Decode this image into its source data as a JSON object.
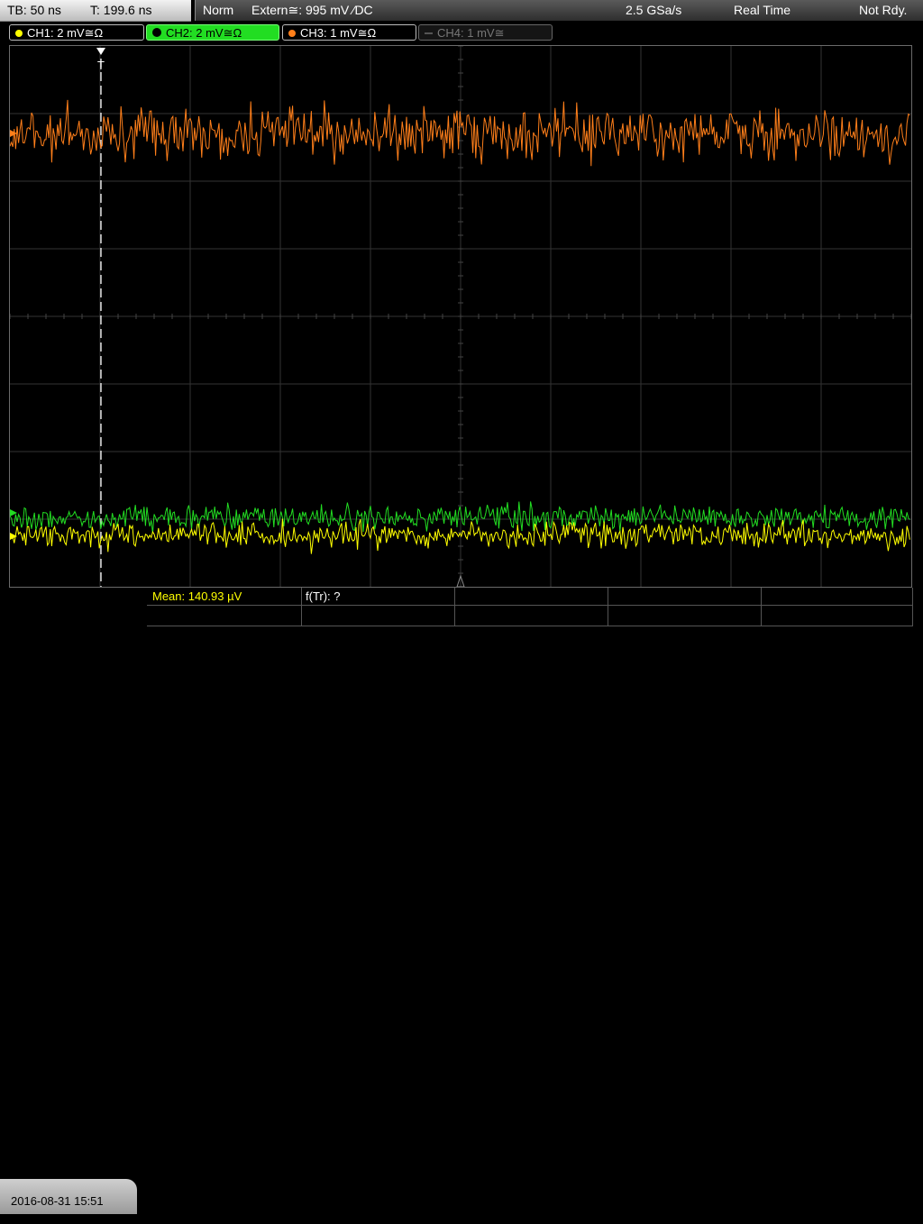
{
  "header": {
    "timebase": "TB: 50 ns",
    "trigger_time": "T: 199.6 ns",
    "mode": "Norm",
    "trigger_source": "Extern≅: 995 mV ⁄DC",
    "sample_rate": "2.5 GSa/s",
    "acq_mode": "Real Time",
    "status": "Not Rdy."
  },
  "channels": [
    {
      "label": "CH1: 2 mV≅Ω",
      "color": "#ffff00",
      "state": "on"
    },
    {
      "label": "CH2: 2 mV≅Ω",
      "color": "#22dd22",
      "state": "selected"
    },
    {
      "label": "CH3: 1 mV≅Ω",
      "color": "#ff7f1a",
      "state": "on"
    },
    {
      "label": "CH4: 1 mV≅",
      "color": "#777777",
      "state": "off"
    }
  ],
  "trigger_marker": "T",
  "measurements": {
    "mean": "Mean: 140.93 µV",
    "ftr": "f(Tr): ?"
  },
  "datetime": "2016-08-31 15:51",
  "colors": {
    "ch1": "#ffff00",
    "ch2": "#22dd22",
    "ch3": "#ff7f1a",
    "grid": "#3a3a3a",
    "trigger_line": "#ffffff"
  }
}
